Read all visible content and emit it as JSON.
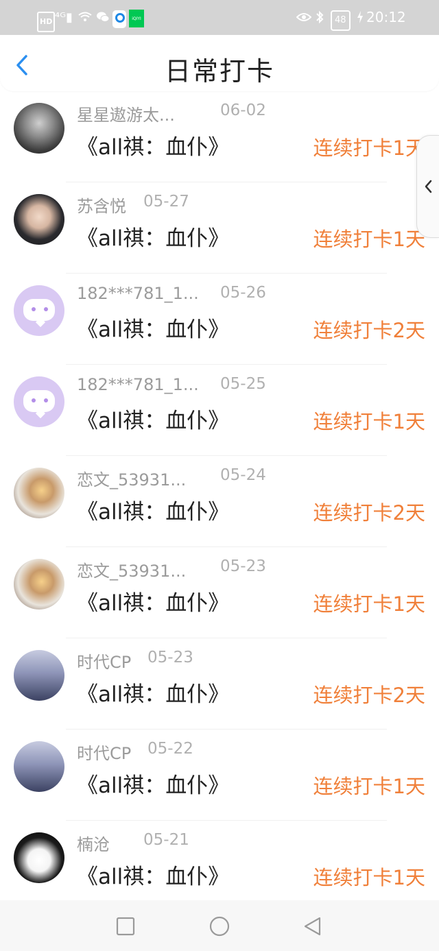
{
  "status_bar": {
    "hd": "HD",
    "signal": "⁴ᴳ▮",
    "wifi_icon": "wifi-icon",
    "wechat_icon": "wechat-icon",
    "iqiyi": "iQIYI",
    "battery": "48",
    "time": "20:12"
  },
  "header": {
    "title": "日常打卡",
    "back_icon": "chevron-left-icon"
  },
  "checkins": [
    {
      "user": "星星遨游太...",
      "date": "06-02",
      "book": "《all祺：血仆》",
      "streak": "连续打卡1天",
      "avatar": "photo-dark"
    },
    {
      "user": "苏含悦",
      "date": "05-27",
      "book": "《all祺：血仆》",
      "streak": "连续打卡1天",
      "avatar": "photo-boy"
    },
    {
      "user": "182***781_1...",
      "date": "05-26",
      "book": "《all祺：血仆》",
      "streak": "连续打卡2天",
      "avatar": "default"
    },
    {
      "user": "182***781_1...",
      "date": "05-25",
      "book": "《all祺：血仆》",
      "streak": "连续打卡1天",
      "avatar": "default"
    },
    {
      "user": "恋文_53931...",
      "date": "05-24",
      "book": "《all祺：血仆》",
      "streak": "连续打卡2天",
      "avatar": "photo-warm"
    },
    {
      "user": "恋文_53931...",
      "date": "05-23",
      "book": "《all祺：血仆》",
      "streak": "连续打卡1天",
      "avatar": "photo-warm"
    },
    {
      "user": "时代CP",
      "date": "05-23",
      "book": "《all祺：血仆》",
      "streak": "连续打卡2天",
      "avatar": "photo-group"
    },
    {
      "user": "时代CP",
      "date": "05-22",
      "book": "《all祺：血仆》",
      "streak": "连续打卡1天",
      "avatar": "photo-group"
    },
    {
      "user": "楠沧",
      "date": "05-21",
      "book": "《all祺：血仆》",
      "streak": "连续打卡1天",
      "avatar": "photo-anime"
    }
  ],
  "colors": {
    "accent": "#f0803a",
    "back_icon": "#2b8ff0",
    "username": "#9b9b9b",
    "date": "#b0b0b0",
    "default_avatar": "#d9c9f3"
  },
  "side_handle_icon": "chevron-left-icon",
  "system_nav": {
    "recent_icon": "square-icon",
    "home_icon": "circle-icon",
    "back_icon": "triangle-back-icon"
  }
}
